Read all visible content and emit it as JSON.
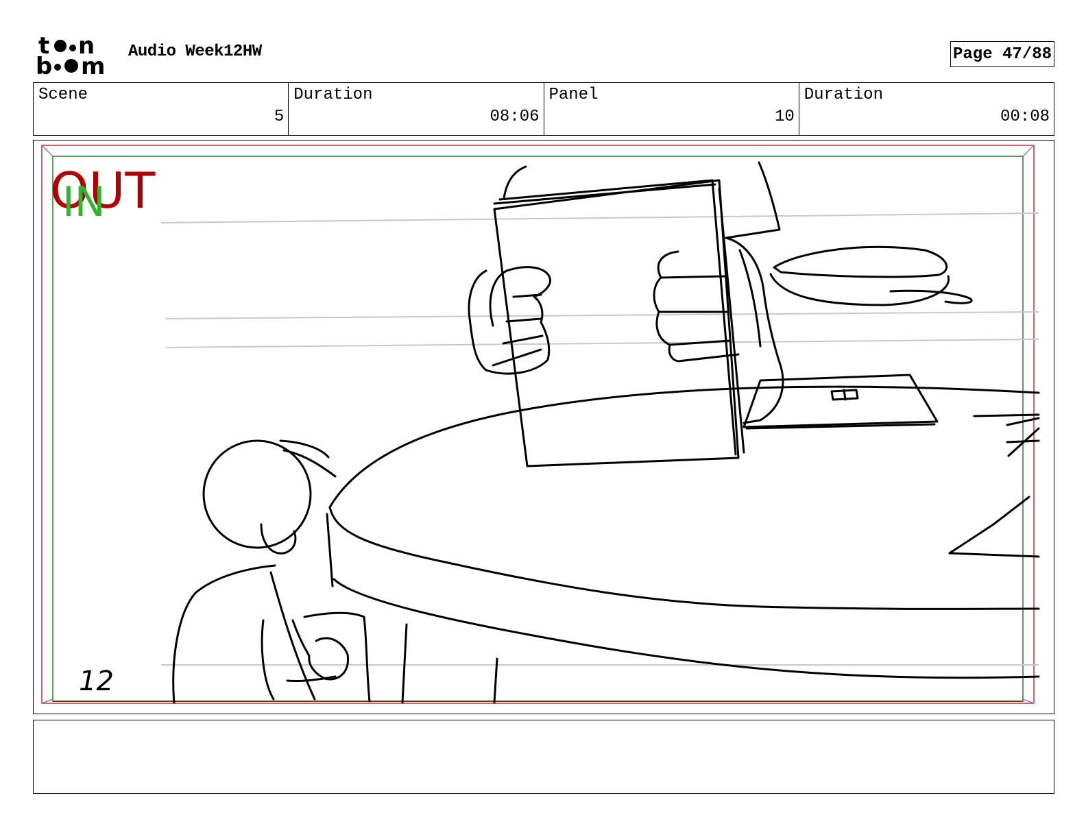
{
  "header": {
    "logo_label": "toon boom",
    "project_title": "Audio Week12HW",
    "page_label": "Page 47/88"
  },
  "info": {
    "scene_label": "Scene",
    "scene_value": "5",
    "scene_duration_label": "Duration",
    "scene_duration_value": "08:06",
    "panel_label": "Panel",
    "panel_value": "10",
    "panel_duration_label": "Duration",
    "panel_duration_value": "00:08"
  },
  "panel": {
    "out_marker": "OUT",
    "in_marker": "IN",
    "sketch_number": "12",
    "colors": {
      "out": "#b00000",
      "in": "#2db52d",
      "safe_outer": "#c03040",
      "safe_inner": "#2d7a2d",
      "corner": "#8a7ad8",
      "guide": "#c8c8c8"
    }
  },
  "notes": {
    "text": ""
  }
}
